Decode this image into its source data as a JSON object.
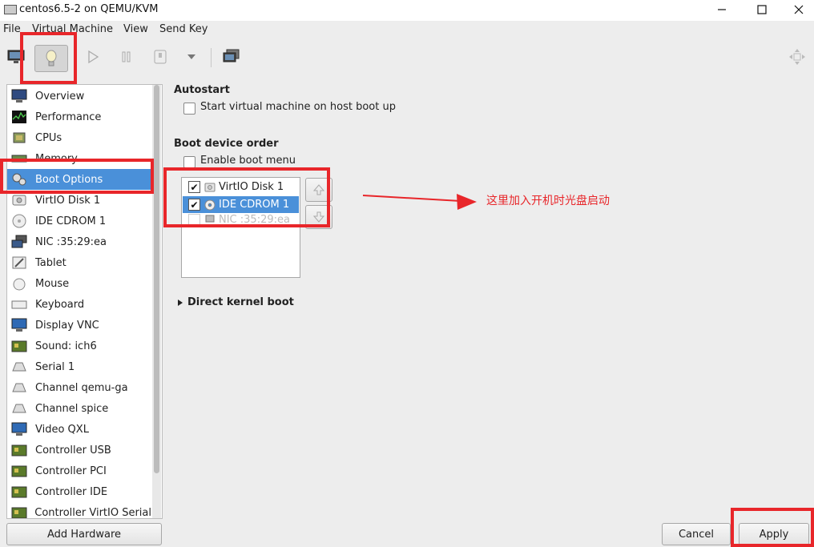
{
  "window": {
    "title": "centos6.5-2 on QEMU/KVM"
  },
  "menu": [
    "File",
    "Virtual Machine",
    "View",
    "Send Key"
  ],
  "sidebar": {
    "items": [
      {
        "label": "Overview",
        "icon": "monitor-icon"
      },
      {
        "label": "Performance",
        "icon": "performance-graph-icon"
      },
      {
        "label": "CPUs",
        "icon": "cpu-chip-icon"
      },
      {
        "label": "Memory",
        "icon": "memory-module-icon"
      },
      {
        "label": "Boot Options",
        "icon": "gears-icon",
        "selected": true
      },
      {
        "label": "VirtIO Disk 1",
        "icon": "disk-drive-icon"
      },
      {
        "label": "IDE CDROM 1",
        "icon": "cdrom-icon"
      },
      {
        "label": "NIC :35:29:ea",
        "icon": "network-icon"
      },
      {
        "label": "Tablet",
        "icon": "tablet-icon"
      },
      {
        "label": "Mouse",
        "icon": "mouse-icon"
      },
      {
        "label": "Keyboard",
        "icon": "keyboard-icon"
      },
      {
        "label": "Display VNC",
        "icon": "display-icon"
      },
      {
        "label": "Sound: ich6",
        "icon": "sound-card-icon"
      },
      {
        "label": "Serial 1",
        "icon": "serial-port-icon"
      },
      {
        "label": "Channel qemu-ga",
        "icon": "channel-icon"
      },
      {
        "label": "Channel spice",
        "icon": "channel-icon"
      },
      {
        "label": "Video QXL",
        "icon": "video-monitor-icon"
      },
      {
        "label": "Controller USB",
        "icon": "controller-card-icon"
      },
      {
        "label": "Controller PCI",
        "icon": "controller-card-icon"
      },
      {
        "label": "Controller IDE",
        "icon": "controller-card-icon"
      },
      {
        "label": "Controller VirtIO Serial",
        "icon": "controller-card-icon"
      }
    ]
  },
  "add_hardware_label": "Add Hardware",
  "autostart": {
    "header": "Autostart",
    "checkbox_label": "Start virtual machine on host boot up"
  },
  "boot": {
    "header": "Boot device order",
    "enable_menu_label": "Enable boot menu",
    "devices": [
      {
        "label": "VirtIO Disk 1",
        "checked": true
      },
      {
        "label": "IDE CDROM 1",
        "checked": true,
        "selected": true
      },
      {
        "label": "NIC :35:29:ea",
        "checked": false
      }
    ]
  },
  "direct_kernel_label": "Direct kernel boot",
  "annotation_note": "这里加入开机时光盘启动",
  "buttons": {
    "cancel": "Cancel",
    "apply": "Apply"
  },
  "colors": {
    "selection": "#4a90d9",
    "annotation_red": "#e8262a"
  }
}
